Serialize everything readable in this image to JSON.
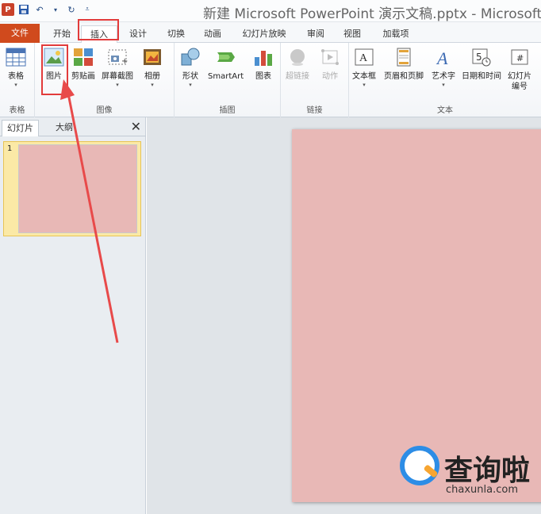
{
  "title": "新建 Microsoft PowerPoint 演示文稿.pptx - Microsoft",
  "quick_access": {
    "app_icon_letter": "P"
  },
  "tabs": [
    {
      "label": "文件"
    },
    {
      "label": "开始"
    },
    {
      "label": "插入"
    },
    {
      "label": "设计"
    },
    {
      "label": "切换"
    },
    {
      "label": "动画"
    },
    {
      "label": "幻灯片放映"
    },
    {
      "label": "审阅"
    },
    {
      "label": "视图"
    },
    {
      "label": "加载项"
    }
  ],
  "active_tab": "插入",
  "ribbon": {
    "groups": {
      "table": {
        "label": "表格",
        "buttons": [
          {
            "label": "表格"
          }
        ]
      },
      "image": {
        "label": "图像",
        "buttons": [
          {
            "label": "图片"
          },
          {
            "label": "剪贴画"
          },
          {
            "label": "屏幕截图"
          },
          {
            "label": "相册"
          }
        ]
      },
      "illustration": {
        "label": "插图",
        "buttons": [
          {
            "label": "形状"
          },
          {
            "label": "SmartArt"
          },
          {
            "label": "图表"
          }
        ]
      },
      "link": {
        "label": "链接",
        "buttons": [
          {
            "label": "超链接"
          },
          {
            "label": "动作"
          }
        ]
      },
      "text": {
        "label": "文本",
        "buttons": [
          {
            "label": "文本框"
          },
          {
            "label": "页眉和页脚"
          },
          {
            "label": "艺术字"
          },
          {
            "label": "日期和时间"
          },
          {
            "label": "幻灯片\n编号"
          }
        ]
      }
    }
  },
  "side_panel": {
    "tabs": [
      {
        "label": "幻灯片"
      },
      {
        "label": "大纲"
      }
    ],
    "close_glyph": "✕",
    "slides": [
      {
        "number": "1"
      }
    ]
  },
  "watermark": {
    "text": "查询啦",
    "url": "chaxunla.com"
  },
  "colors": {
    "slide_fill": "#e8b8b6",
    "file_tab": "#d04a1d",
    "highlight": "#e23b3b"
  }
}
